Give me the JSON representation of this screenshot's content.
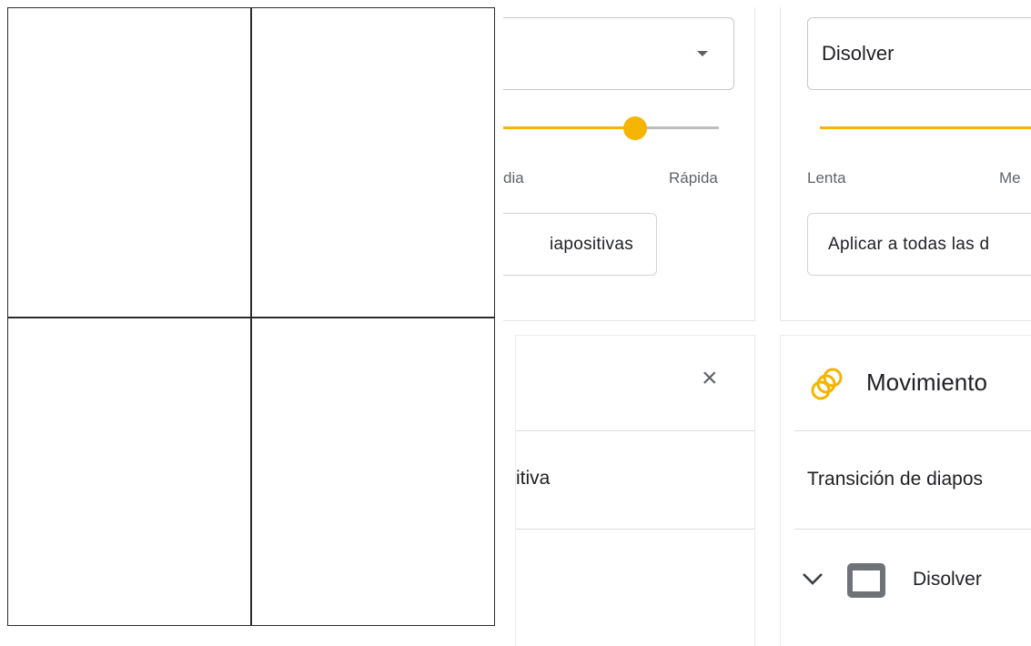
{
  "transition_panel_right": {
    "title": "Movimiento",
    "section_label": "Transición de diapos",
    "transition_item": "Disolver",
    "dropdown_value": "Disolver",
    "speed_left_label": "Lenta",
    "speed_mid_label": "Me",
    "apply_button": "Aplicar a todas las d",
    "accent_color": "#f4b400"
  },
  "transition_panel_left": {
    "speed_mid_label": "dia",
    "speed_right_label": "Rápida",
    "apply_button": "iapositivas",
    "section_label": "itiva",
    "close_glyph": "×"
  }
}
